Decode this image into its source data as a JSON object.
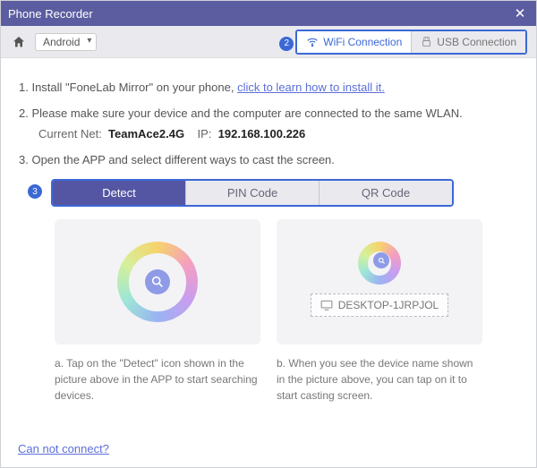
{
  "window": {
    "title": "Phone Recorder"
  },
  "toolbar": {
    "platform": "Android",
    "wifi_label": "WiFi Connection",
    "usb_label": "USB Connection",
    "badge2": "2"
  },
  "steps": {
    "s1a": "1. Install \"FoneLab Mirror\" on your phone, ",
    "s1link": "click to learn how to install it.",
    "s2": "2. Please make sure your device and the computer are connected to the same WLAN.",
    "net_label": "Current Net:",
    "net_value": "TeamAce2.4G",
    "ip_label": "IP:",
    "ip_value": "192.168.100.226",
    "s3": "3. Open the APP and select different ways to cast the screen."
  },
  "tabs": {
    "badge3": "3",
    "detect": "Detect",
    "pin": "PIN Code",
    "qr": "QR Code"
  },
  "device": {
    "name": "DESKTOP-1JRPJOL"
  },
  "captions": {
    "a": "a. Tap on the \"Detect\" icon shown in the picture above in the APP to start searching devices.",
    "b": "b. When you see the device name shown in the picture above, you can tap on it to start casting screen."
  },
  "footer": {
    "help": "Can not connect?"
  }
}
